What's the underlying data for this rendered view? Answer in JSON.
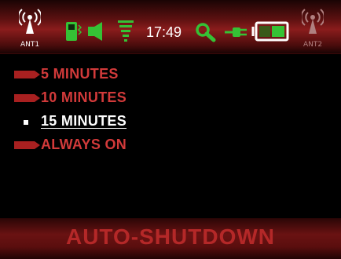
{
  "status_bar": {
    "antenna1_label": "ANT1",
    "antenna2_label": "ANT2",
    "time": "17:49",
    "icons": [
      "antenna-icon",
      "device-icon",
      "speaker-icon",
      "signal-strength-icon",
      "search-icon",
      "power-plug-icon",
      "battery-icon",
      "antenna-icon"
    ],
    "battery_level": 0.5
  },
  "menu": {
    "items": [
      {
        "label": "5 MINUTES",
        "selected": false
      },
      {
        "label": "10 MINUTES",
        "selected": false
      },
      {
        "label": "15 MINUTES",
        "selected": true
      },
      {
        "label": "ALWAYS ON",
        "selected": false
      }
    ]
  },
  "title": "AUTO-SHUTDOWN",
  "colors": {
    "accent_red": "#d23a3a",
    "selected_text": "#ffffff",
    "status_green": "#35c235",
    "background": "#000000"
  }
}
